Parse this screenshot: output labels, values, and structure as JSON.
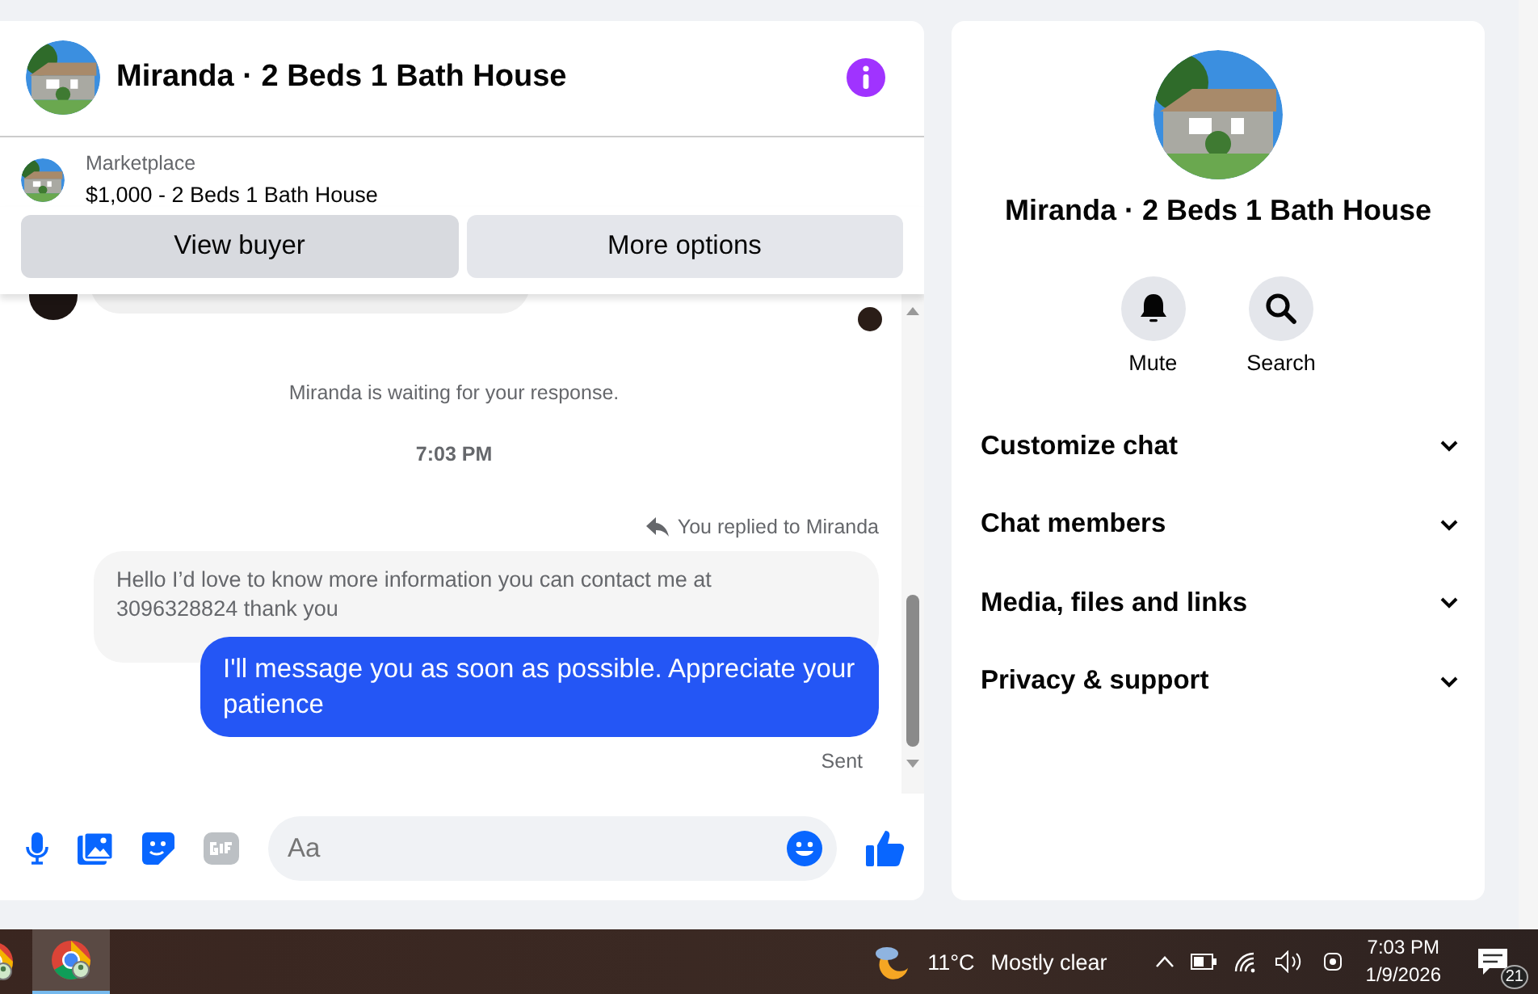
{
  "chat": {
    "title": "Miranda · 2 Beds 1 Bath House",
    "listing": {
      "source": "Marketplace",
      "title": "$1,000 - 2 Beds 1 Bath House"
    },
    "buttons": [
      {
        "label": "View buyer",
        "selected": true
      },
      {
        "label": "More options",
        "selected": false
      }
    ],
    "messages": [
      {
        "kind": "notice",
        "text": "Miranda is waiting for your response."
      },
      {
        "kind": "time",
        "text": "7:03 PM"
      },
      {
        "kind": "reply_note",
        "text": "You replied to Miranda"
      },
      {
        "kind": "quoted",
        "text": "Hello I’d love to know more information you can contact me at 3096328824 thank you"
      },
      {
        "kind": "outgoing",
        "text": "I'll message you as soon as possible. Appreciate your patience"
      },
      {
        "kind": "status",
        "text": "Sent"
      }
    ],
    "composer": {
      "placeholder": "Aa"
    }
  },
  "details": {
    "title": "Miranda · 2 Beds 1 Bath House",
    "actions": [
      {
        "kind": "mute",
        "label": "Mute"
      },
      {
        "kind": "search",
        "label": "Search"
      }
    ],
    "sections": [
      {
        "label": "Customize chat",
        "expanded": false
      },
      {
        "label": "Chat members",
        "expanded": false
      },
      {
        "label": "Media, files and links",
        "expanded": false
      },
      {
        "label": "Privacy & support",
        "expanded": false
      }
    ]
  },
  "taskbar": {
    "apps": [
      {
        "selected": false
      },
      {
        "selected": true
      }
    ],
    "weather": {
      "temp": "11°C",
      "condition": "Mostly clear"
    },
    "time": "7:03 PM",
    "date": "1/9/2026",
    "notifications": "21"
  }
}
